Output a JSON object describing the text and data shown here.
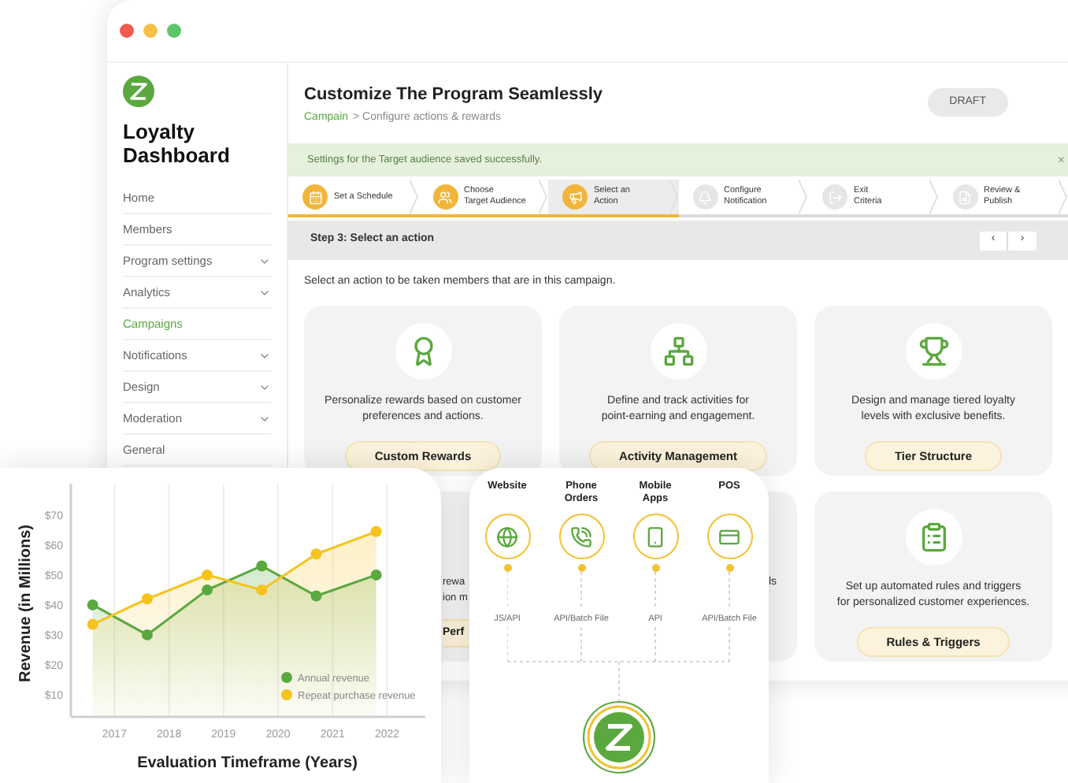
{
  "sidebar": {
    "title": "Loyalty Dashboard",
    "items": [
      {
        "label": "Home",
        "selected": false,
        "expandable": false
      },
      {
        "label": "Members",
        "selected": false,
        "expandable": false
      },
      {
        "label": "Program settings",
        "selected": false,
        "expandable": true
      },
      {
        "label": "Analytics",
        "selected": false,
        "expandable": true
      },
      {
        "label": "Campaigns",
        "selected": true,
        "expandable": false
      },
      {
        "label": "Notifications",
        "selected": false,
        "expandable": true
      },
      {
        "label": "Design",
        "selected": false,
        "expandable": true
      },
      {
        "label": "Moderation",
        "selected": false,
        "expandable": true
      },
      {
        "label": "General",
        "selected": false,
        "expandable": false
      }
    ]
  },
  "header": {
    "title": "Customize The Program Seamlessly",
    "breadcrumb_link": "Campain",
    "breadcrumb_rest": "> Configure actions & rewards",
    "status": "DRAFT"
  },
  "banner": {
    "message": "Settings for the Target audience saved successfully.",
    "close": "×"
  },
  "steps": [
    {
      "lines": [
        "Set a Schedule"
      ],
      "kind": "schedule",
      "completed": true,
      "selected": false
    },
    {
      "lines": [
        "Choose",
        "Target Audience"
      ],
      "kind": "audience",
      "completed": true,
      "selected": false
    },
    {
      "lines": [
        "Select an",
        "Action"
      ],
      "kind": "action",
      "completed": true,
      "selected": true
    },
    {
      "lines": [
        "Configure",
        "Notification"
      ],
      "kind": "notification",
      "completed": false,
      "selected": false
    },
    {
      "lines": [
        "Exit",
        "Criteria"
      ],
      "kind": "exit",
      "completed": false,
      "selected": false
    },
    {
      "lines": [
        "Review &",
        "Publish"
      ],
      "kind": "review",
      "completed": false,
      "selected": false
    }
  ],
  "step_header": {
    "title": "Step 3: Select an action",
    "prev": "‹",
    "next": "›"
  },
  "instruction": "Select an action to be taken members that are in this campaign.",
  "cards": [
    {
      "kind": "rewards",
      "lines": [
        "Personalize rewards based on customer",
        "preferences and actions."
      ],
      "button": "Custom Rewards"
    },
    {
      "kind": "activity",
      "lines": [
        "Define and track activities for",
        "point-earning and engagement."
      ],
      "button": "Activity Management"
    },
    {
      "kind": "tiers",
      "lines": [
        "Design and manage tiered loyalty",
        "levels with exclusive benefits."
      ],
      "button": "Tier Structure"
    },
    {
      "kind": "hidden-left",
      "lines": [
        "rewa",
        "ion m"
      ],
      "button": "Perf"
    },
    {
      "kind": "hidden-middle",
      "lines": [
        "ls"
      ]
    },
    {
      "kind": "rules",
      "lines": [
        "Set up automated rules and triggers",
        "for personalized customer experiences."
      ],
      "button": "Rules & Triggers"
    }
  ],
  "revenue_panel": {
    "chart_data": {
      "type": "area",
      "xlabel": "Evaluation Timeframe (Years)",
      "ylabel": "Revenue (in Millions)",
      "x": [
        2016.6,
        2017.6,
        2018.7,
        2019.7,
        2020.7,
        2021.8
      ],
      "series": [
        {
          "name": "Annual revenue",
          "color": "#5ba83f",
          "marker": "circle",
          "values": [
            40,
            30,
            45,
            53,
            43,
            50
          ]
        },
        {
          "name": "Repeat purchase revenue",
          "color": "#f6c31c",
          "marker": "circle",
          "values": [
            33.5,
            42,
            50,
            45,
            57,
            64.5
          ]
        }
      ],
      "xlim": [
        2016.2,
        2022.7
      ],
      "ylim": [
        2.6,
        80.5
      ],
      "xticks": [
        2017,
        2018,
        2019,
        2020,
        2021,
        2022
      ],
      "yticks": [
        {
          "value": 10,
          "label": "$10"
        },
        {
          "value": 20,
          "label": "$20"
        },
        {
          "value": 30,
          "label": "$30"
        },
        {
          "value": 40,
          "label": "$40"
        },
        {
          "value": 50,
          "label": "$50"
        },
        {
          "value": 60,
          "label": "$60"
        },
        {
          "value": 70,
          "label": "$70"
        }
      ],
      "grid": true,
      "legend": true
    }
  },
  "integrations": {
    "channels": [
      {
        "name": [
          "Website"
        ],
        "kind": "web",
        "method": "JS/API"
      },
      {
        "name": [
          "Phone",
          "Orders"
        ],
        "kind": "phone",
        "method": "API/Batch File"
      },
      {
        "name": [
          "Mobile",
          "Apps"
        ],
        "kind": "mobile",
        "method": "API"
      },
      {
        "name": [
          "POS"
        ],
        "kind": "pos",
        "method": "API/Batch File"
      }
    ]
  }
}
